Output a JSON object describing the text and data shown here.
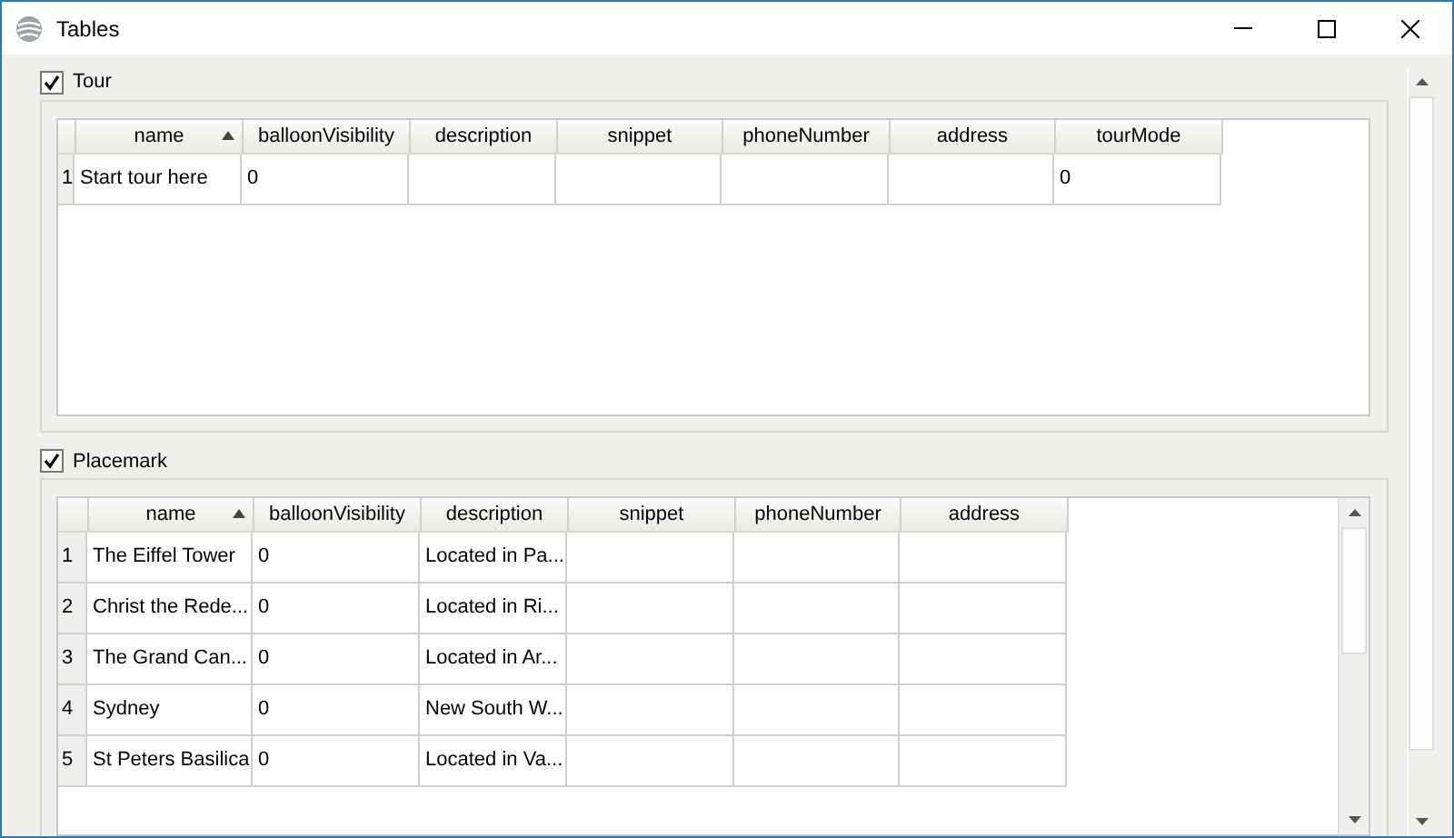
{
  "window": {
    "title": "Tables"
  },
  "groups": [
    {
      "label": "Tour",
      "checked": true,
      "columns": [
        {
          "label": "name",
          "sorted": true
        },
        {
          "label": "balloonVisibility",
          "sorted": false
        },
        {
          "label": "description",
          "sorted": false
        },
        {
          "label": "snippet",
          "sorted": false
        },
        {
          "label": "phoneNumber",
          "sorted": false
        },
        {
          "label": "address",
          "sorted": false
        },
        {
          "label": "tourMode",
          "sorted": false
        }
      ],
      "rows": [
        {
          "number": "1",
          "cells": [
            "Start tour here",
            "0",
            "",
            "",
            "",
            "",
            "0"
          ]
        }
      ]
    },
    {
      "label": "Placemark",
      "checked": true,
      "columns": [
        {
          "label": "name",
          "sorted": true
        },
        {
          "label": "balloonVisibility",
          "sorted": false
        },
        {
          "label": "description",
          "sorted": false
        },
        {
          "label": "snippet",
          "sorted": false
        },
        {
          "label": "phoneNumber",
          "sorted": false
        },
        {
          "label": "address",
          "sorted": false
        }
      ],
      "rows": [
        {
          "number": "1",
          "cells": [
            "The Eiffel Tower",
            "0",
            "Located in Pa...",
            "",
            "",
            ""
          ]
        },
        {
          "number": "2",
          "cells": [
            "Christ the Rede...",
            "0",
            "Located in Ri...",
            "",
            "",
            ""
          ]
        },
        {
          "number": "3",
          "cells": [
            "The Grand Can...",
            "0",
            "Located in Ar...",
            "",
            "",
            ""
          ]
        },
        {
          "number": "4",
          "cells": [
            "Sydney",
            "0",
            "New South W...",
            "",
            "",
            ""
          ]
        },
        {
          "number": "5",
          "cells": [
            "St Peters Basilica",
            "0",
            "Located in Va...",
            "",
            "",
            ""
          ]
        }
      ]
    }
  ]
}
